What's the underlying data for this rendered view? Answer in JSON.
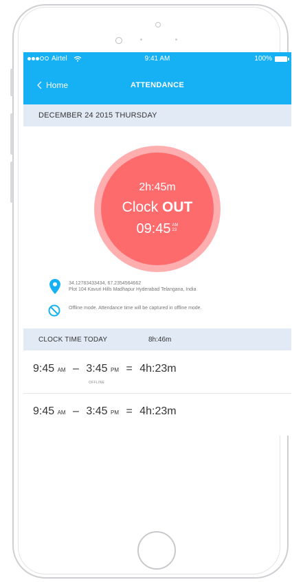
{
  "status_bar": {
    "carrier": "Airtel",
    "time": "9:41 AM",
    "battery": "100%"
  },
  "nav": {
    "back_label": "Home",
    "title": "ATTENDANCE"
  },
  "date_bar": {
    "text": "DECEMBER 24  2015   THURSDAY"
  },
  "clock": {
    "duration": "2h:45m",
    "label_prefix": "Clock ",
    "label_action": "OUT",
    "time": "09:45",
    "ampm": "AM",
    "seconds": "23"
  },
  "location": {
    "coords": "34.12783433434, 67.2354564662",
    "address": "Plot 104 Kavuri Hills Madhapur Hyderabad Telangana, India"
  },
  "offline_notice": {
    "text": "Offline mode. Attendance time will be captured in offline mode."
  },
  "clock_today": {
    "label": "CLOCK TIME TODAY",
    "value": "8h:46m"
  },
  "entries": [
    {
      "start": "9:45",
      "start_ampm": "AM",
      "end": "3:45",
      "end_ampm": "PM",
      "equals": "=",
      "total": "4h:23m",
      "tag": "OFFLINE"
    },
    {
      "start": "9:45",
      "start_ampm": "AM",
      "end": "3:45",
      "end_ampm": "PM",
      "equals": "=",
      "total": "4h:23m",
      "tag": ""
    }
  ],
  "colors": {
    "primary": "#16b0f4",
    "section_bg": "#e2eaf5",
    "clock_inner": "#fd6b6d",
    "clock_outer": "#ffaeb0"
  },
  "icons": {
    "location": "map-pin-icon",
    "offline": "no-entry-icon",
    "back": "chevron-left-icon"
  }
}
